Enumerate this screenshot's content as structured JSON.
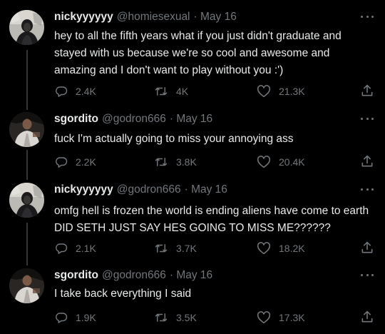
{
  "tweets": [
    {
      "name": "nickyyyyyy",
      "handle": "@homiesexual",
      "date": "· May 16",
      "text": "hey to all the fifth years what if you just didn't graduate and\nstayed with us because we're so cool and awesome and\namazing and I don't want to play without you :')",
      "replies": "2.4K",
      "retweets": "4K",
      "likes": "21.3K"
    },
    {
      "name": "sgordito",
      "handle": "@godron666",
      "date": "· May 16",
      "text": "fuck I'm actually going to miss your annoying ass",
      "replies": "2.2K",
      "retweets": "3.8K",
      "likes": "20.4K"
    },
    {
      "name": "nickyyyyyy",
      "handle": "@godron666",
      "date": "· May 16",
      "text": "omfg hell is frozen the world is ending aliens have come to earth\nDID SETH JUST SAY HES GOING TO MISS ME??????",
      "replies": "2.1K",
      "retweets": "3.7K",
      "likes": "18.2K"
    },
    {
      "name": "sgordito",
      "handle": "@godron666",
      "date": "· May 16",
      "text": "I take back everything I said",
      "replies": "1.9K",
      "retweets": "3.5K",
      "likes": "17.3K"
    }
  ],
  "icons": {
    "reply": "speech-bubble",
    "retweet": "retweet-arrows",
    "like": "heart-outline",
    "share": "share-upload",
    "more": "horizontal-ellipsis"
  },
  "colors": {
    "background": "#000000",
    "primary_text": "#e7e9ea",
    "secondary_text": "#71767b",
    "thread_line": "#333639"
  }
}
